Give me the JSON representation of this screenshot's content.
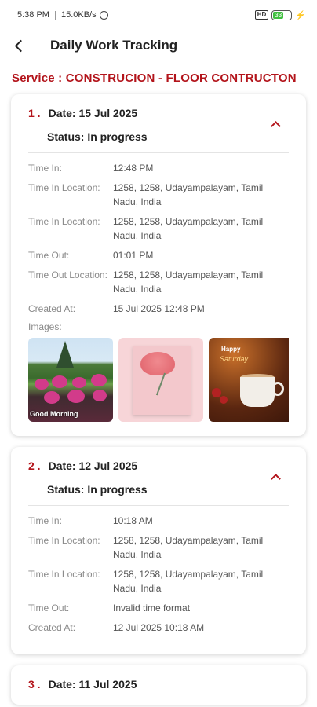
{
  "status_bar": {
    "time": "5:38 PM",
    "network_speed": "15.0KB/s",
    "battery_level": "33"
  },
  "header": {
    "title": "Daily Work Tracking"
  },
  "service": {
    "label": "Service : CONSTRUCION - FLOOR CONTRUCTON"
  },
  "cards": [
    {
      "index": "1 .",
      "date": "Date: 15 Jul 2025",
      "status": "Status: In progress",
      "rows": [
        {
          "label": "Time In:",
          "value": "12:48 PM"
        },
        {
          "label": "Time In Location:",
          "value": "1258, 1258, Udayampalayam, Tamil Nadu, India"
        },
        {
          "label": "Time In Location:",
          "value": "1258, 1258, Udayampalayam, Tamil Nadu, India"
        },
        {
          "label": "Time Out:",
          "value": "01:01 PM"
        },
        {
          "label": "Time Out Location:",
          "value": "1258, 1258, Udayampalayam, Tamil Nadu, India"
        },
        {
          "label": "Created At:",
          "value": "15 Jul 2025 12:48 PM"
        }
      ],
      "images_label": "Images:",
      "images": [
        {
          "caption": "Good Morning"
        },
        {
          "caption": "Carnation"
        },
        {
          "caption": "Happy Saturday"
        }
      ]
    },
    {
      "index": "2 .",
      "date": "Date: 12 Jul 2025",
      "status": "Status: In progress",
      "rows": [
        {
          "label": "Time In:",
          "value": "10:18 AM"
        },
        {
          "label": "Time In Location:",
          "value": "1258, 1258, Udayampalayam, Tamil Nadu, India"
        },
        {
          "label": "Time In Location:",
          "value": "1258, 1258, Udayampalayam, Tamil Nadu, India"
        },
        {
          "label": "Time Out:",
          "value": "Invalid time format"
        },
        {
          "label": "Created At:",
          "value": "12 Jul 2025 10:18 AM"
        }
      ]
    },
    {
      "index": "3 .",
      "date": "Date: 11 Jul 2025"
    }
  ],
  "colors": {
    "accent": "#b3141b",
    "label_gray": "#8a8a8a"
  }
}
